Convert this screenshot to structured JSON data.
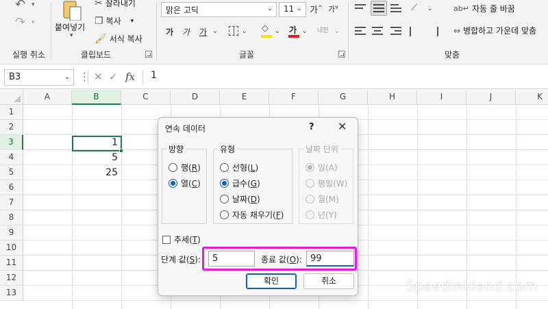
{
  "ribbon": {
    "undo_group_label": "실행 취소",
    "clipboard": {
      "group_label": "클립보드",
      "paste_label": "붙여넣기",
      "cut_label": "잘라내기",
      "copy_label": "복사",
      "format_painter_label": "서식 복사"
    },
    "font": {
      "group_label": "글꼴",
      "font_name": "맑은 고딕",
      "font_size": "11",
      "grow_label": "가",
      "shrink_label": "가",
      "bold_label": "가",
      "italic_label": "가",
      "underline_label": "가",
      "font_color_label": "가",
      "phonetic_label": "내천"
    },
    "alignment": {
      "group_label": "맞춤",
      "wrap_text_label": "자동 줄 바꿈",
      "merge_label": "병합하고 가운데 맞춤"
    }
  },
  "formula_bar": {
    "name_box": "B3",
    "fx_label": "fx",
    "formula": "1"
  },
  "grid": {
    "columns": [
      "A",
      "B",
      "C",
      "D",
      "E",
      "F",
      "G",
      "H",
      "I",
      "J",
      "K"
    ],
    "active_column": "B",
    "rows": [
      "1",
      "2",
      "3",
      "4",
      "5",
      "6",
      "7",
      "8",
      "9",
      "10",
      "11",
      "12",
      "13"
    ],
    "active_row": "3",
    "cells": [
      {
        "ref": "B3",
        "value": "1"
      },
      {
        "ref": "B4",
        "value": "5"
      },
      {
        "ref": "B5",
        "value": "25"
      }
    ]
  },
  "dialog": {
    "title": "연속 데이터",
    "help_label": "?",
    "direction": {
      "legend": "방향",
      "options": [
        {
          "text": "행(",
          "key": "R",
          "checked": false
        },
        {
          "text": "열(",
          "key": "C",
          "checked": true
        }
      ]
    },
    "type": {
      "legend": "유형",
      "options": [
        {
          "text": "선형(",
          "key": "L",
          "checked": false
        },
        {
          "text": "급수(",
          "key": "G",
          "checked": true
        },
        {
          "text": "날짜(",
          "key": "D",
          "checked": false
        },
        {
          "text": "자동 채우기(",
          "key": "F",
          "checked": false
        }
      ]
    },
    "date_unit": {
      "legend": "날짜 단위",
      "options": [
        {
          "text": "일(A)",
          "checked": true
        },
        {
          "text": "평일(W)",
          "checked": false
        },
        {
          "text": "월(M)",
          "checked": false
        },
        {
          "text": "년(Y)",
          "checked": false
        }
      ]
    },
    "trend": {
      "text": "추세(",
      "key": "T"
    },
    "step_value": {
      "label": "단계 값(",
      "key": "S",
      "value": "5"
    },
    "stop_value": {
      "label": "종료 값(",
      "key": "O",
      "value": "99"
    },
    "ok_label": "확인",
    "cancel_label": "취소"
  },
  "watermark": "Speedinkland.com",
  "colors": {
    "excel_green": "#1e7b45",
    "accent_blue": "#0f5fb5",
    "highlight_magenta": "#e21ce0"
  }
}
